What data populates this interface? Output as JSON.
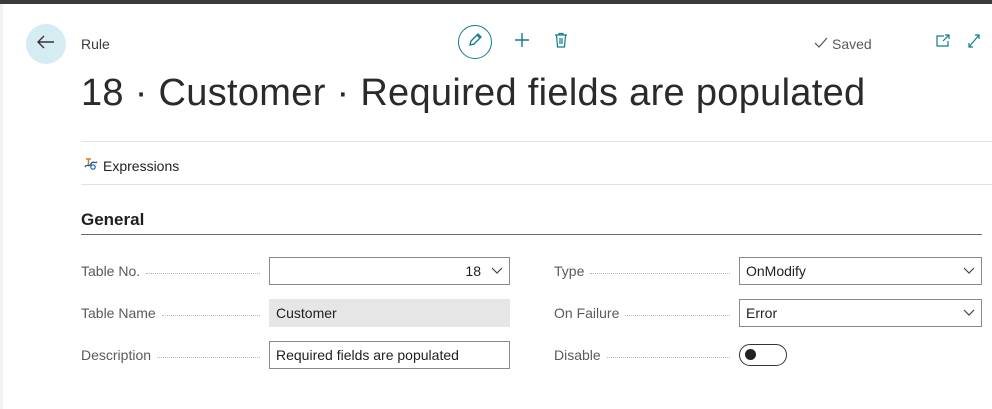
{
  "header": {
    "caption": "Rule",
    "saved_label": "Saved",
    "title": "18 · Customer · Required fields are populated"
  },
  "action_bar": {
    "expressions_label": "Expressions"
  },
  "section": {
    "title": "General"
  },
  "fields_left": [
    {
      "label": "Table No.",
      "value": "18"
    },
    {
      "label": "Table Name",
      "value": "Customer"
    },
    {
      "label": "Description",
      "value": "Required fields are populated"
    }
  ],
  "fields_right": [
    {
      "label": "Type",
      "value": "OnModify"
    },
    {
      "label": "On Failure",
      "value": "Error"
    },
    {
      "label": "Disable",
      "value": false
    }
  ],
  "colors": {
    "accent": "#0f7c8c",
    "back_button_bg": "#d6ecf3",
    "readonly_bg": "#e6e6e6"
  },
  "icons": [
    "back-arrow-icon",
    "pencil-icon",
    "plus-icon",
    "trash-icon",
    "checkmark-icon",
    "open-new-window-icon",
    "expand-icon",
    "expressions-icon",
    "chevron-down-icon"
  ]
}
